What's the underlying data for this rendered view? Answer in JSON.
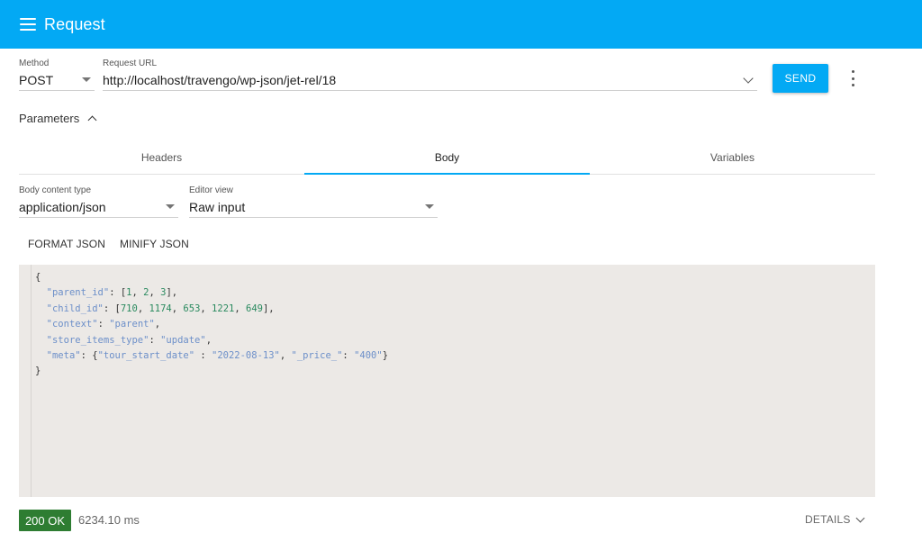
{
  "appbar": {
    "title": "Request",
    "menu_icon": "hamburger-menu-icon"
  },
  "request": {
    "method_label": "Method",
    "method_value": "POST",
    "url_label": "Request URL",
    "url_value": "http://localhost/travengo/wp-json/jet-rel/18",
    "send_label": "SEND",
    "more_icon": "more-vert-icon"
  },
  "parameters": {
    "label": "Parameters",
    "expanded": true
  },
  "tabs": [
    {
      "label": "Headers",
      "active": false
    },
    {
      "label": "Body",
      "active": true
    },
    {
      "label": "Variables",
      "active": false
    }
  ],
  "body": {
    "content_type_label": "Body content type",
    "content_type_value": "application/json",
    "editor_view_label": "Editor view",
    "editor_view_value": "Raw input",
    "format_label": "FORMAT JSON",
    "minify_label": "MINIFY JSON",
    "editor_lines": [
      [
        [
          "{",
          "punc"
        ]
      ],
      [
        [
          "  ",
          "punc"
        ],
        [
          "\"parent_id\"",
          "key"
        ],
        [
          ": [",
          "punc"
        ],
        [
          "1",
          "num"
        ],
        [
          ", ",
          "punc"
        ],
        [
          "2",
          "num"
        ],
        [
          ", ",
          "punc"
        ],
        [
          "3",
          "num"
        ],
        [
          "],",
          "punc"
        ]
      ],
      [
        [
          "  ",
          "punc"
        ],
        [
          "\"child_id\"",
          "key"
        ],
        [
          ": [",
          "punc"
        ],
        [
          "710",
          "num"
        ],
        [
          ", ",
          "punc"
        ],
        [
          "1174",
          "num"
        ],
        [
          ", ",
          "punc"
        ],
        [
          "653",
          "num"
        ],
        [
          ", ",
          "punc"
        ],
        [
          "1221",
          "num"
        ],
        [
          ", ",
          "punc"
        ],
        [
          "649",
          "num"
        ],
        [
          "],",
          "punc"
        ]
      ],
      [
        [
          "  ",
          "punc"
        ],
        [
          "\"context\"",
          "key"
        ],
        [
          ": ",
          "punc"
        ],
        [
          "\"parent\"",
          "str"
        ],
        [
          ",",
          "punc"
        ]
      ],
      [
        [
          "  ",
          "punc"
        ],
        [
          "\"store_items_type\"",
          "key"
        ],
        [
          ": ",
          "punc"
        ],
        [
          "\"update\"",
          "str"
        ],
        [
          ",",
          "punc"
        ]
      ],
      [
        [
          "  ",
          "punc"
        ],
        [
          "\"meta\"",
          "key"
        ],
        [
          ": {",
          "punc"
        ],
        [
          "\"tour_start_date\"",
          "key"
        ],
        [
          " : ",
          "punc"
        ],
        [
          "\"2022-08-13\"",
          "str"
        ],
        [
          ", ",
          "punc"
        ],
        [
          "\"_price_\"",
          "key"
        ],
        [
          ": ",
          "punc"
        ],
        [
          "\"400\"",
          "str"
        ],
        [
          "}",
          "punc"
        ]
      ],
      [
        [
          "}",
          "punc"
        ]
      ]
    ]
  },
  "response": {
    "status": "200 OK",
    "status_color": "#2e7d32",
    "timing": "6234.10 ms",
    "details_label": "DETAILS"
  },
  "colors": {
    "accent": "#03a9f4"
  }
}
